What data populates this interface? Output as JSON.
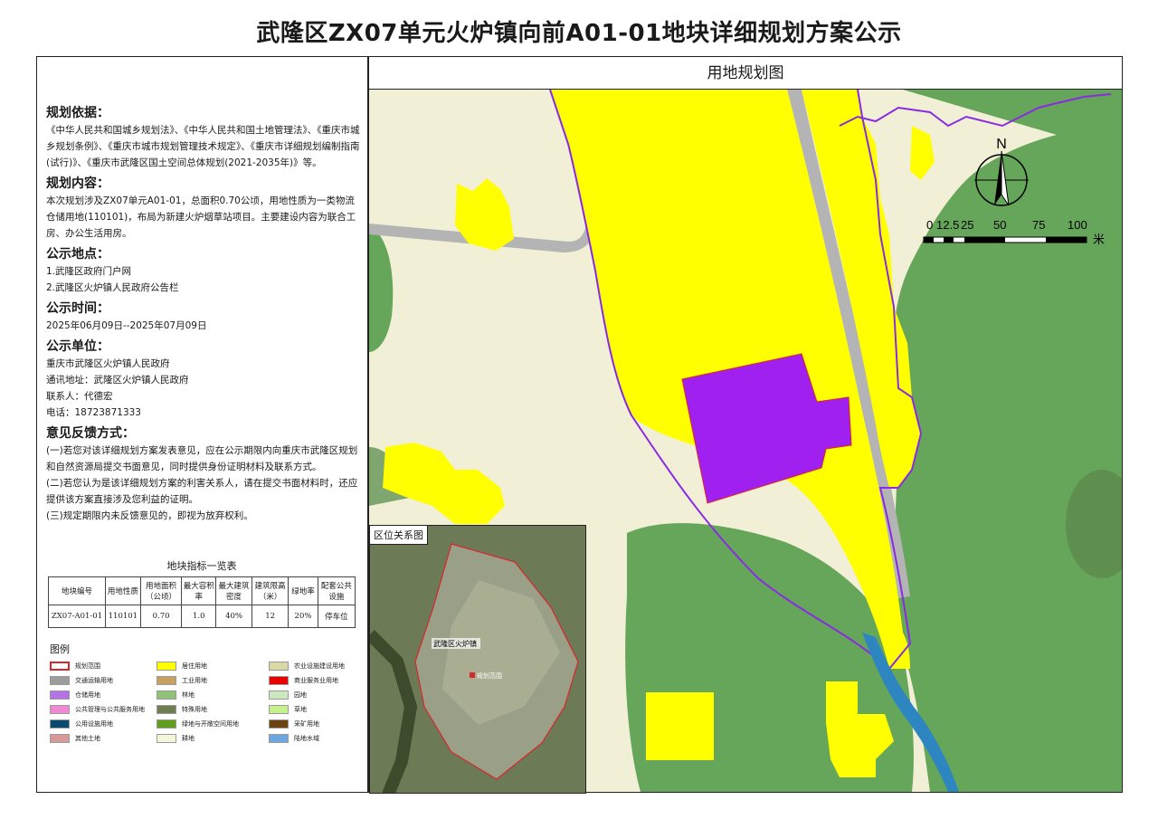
{
  "title": "武隆区ZX07单元火炉镇向前A01-01地块详细规划方案公示",
  "map_title": "用地规划图",
  "notice": {
    "basis_heading": "规划依据：",
    "basis_text": "《中华人民共和国城乡规划法》、《中华人民共和国土地管理法》、《重庆市城乡规划条例》、《重庆市城市规划管理技术规定》、《重庆市详细规划编制指南(试行)》、《重庆市武隆区国土空间总体规划(2021-2035年)》等。",
    "content_heading": "规划内容：",
    "content_text": "本次规划涉及ZX07单元A01-01，总面积0.70公顷，用地性质为一类物流仓储用地(110101)，布局为新建火炉烟草站项目。主要建设内容为联合工房、办公生活用房。",
    "location_heading": "公示地点：",
    "location_1": "1.武隆区政府门户网",
    "location_2": "2.武隆区火炉镇人民政府公告栏",
    "time_heading": "公示时间：",
    "time_text": "2025年06月09日--2025年07月09日",
    "unit_heading": "公示单位：",
    "unit_name": "重庆市武隆区火炉镇人民政府",
    "address": "通讯地址：武隆区火炉镇人民政府",
    "contact": "联系人：代德宏",
    "phone": "电话：18723871333",
    "feedback_heading": "意见反馈方式：",
    "feedback_1": "(一)若您对该详细规划方案发表意见，应在公示期限内向重庆市武隆区规划和自然资源局提交书面意见，同时提供身份证明材料及联系方式。",
    "feedback_2": "(二)若您认为是该详细规划方案的利害关系人，请在提交书面材料时，还应提供该方案直接涉及您利益的证明。",
    "feedback_3": "(三)规定期限内未反馈意见的，即视为放弃权利。"
  },
  "indicator_table": {
    "title": "地块指标一览表",
    "headers": [
      "地块编号",
      "用地性质",
      "用地面积（公顷）",
      "最大容积率",
      "最大建筑密度",
      "建筑限高（米）",
      "绿地率",
      "配套公共设施"
    ],
    "row": [
      "ZX07-A01-01",
      "110101",
      "0.70",
      "1.0",
      "40%",
      "12",
      "20%",
      "停车位"
    ]
  },
  "legend": {
    "title": "图例",
    "items": [
      {
        "label": "规划范围",
        "color": "#ffffff",
        "border": "#d9262c"
      },
      {
        "label": "居住用地",
        "color": "#ffff00"
      },
      {
        "label": "农业设施建设用地",
        "color": "#d9d9a6"
      },
      {
        "label": "交通运输用地",
        "color": "#9c9c9c"
      },
      {
        "label": "工业用地",
        "color": "#c8a062"
      },
      {
        "label": "商业服务业用地",
        "color": "#e60000"
      },
      {
        "label": "仓储用地",
        "color": "#b574e6"
      },
      {
        "label": "林地",
        "color": "#8fc276"
      },
      {
        "label": "园地",
        "color": "#cde8c0"
      },
      {
        "label": "公共管理与公共服务用地",
        "color": "#f08ad2"
      },
      {
        "label": "特殊用地",
        "color": "#6f7d52"
      },
      {
        "label": "草地",
        "color": "#c6f08c"
      },
      {
        "label": "公用设施用地",
        "color": "#0b4a6e"
      },
      {
        "label": "绿地与开敞空间用地",
        "color": "#5f9e1f"
      },
      {
        "label": "采矿用地",
        "color": "#6b4210"
      },
      {
        "label": "其他土地",
        "color": "#d69a9a"
      },
      {
        "label": "耕地",
        "color": "#f5f5dc"
      },
      {
        "label": "陆地水域",
        "color": "#6ea6e0"
      }
    ]
  },
  "inset": {
    "label": "区位关系图",
    "town_label": "武隆区火炉镇",
    "site_label": "规划范围"
  },
  "north_label": "N",
  "scale": {
    "ticks": [
      "0",
      "12.5",
      "25",
      "50",
      "75",
      "100"
    ],
    "unit": "米"
  },
  "colors": {
    "residential": "#ffff00",
    "forest": "#65a65a",
    "farmland": "#f1efd6",
    "road": "#b4b4b4",
    "warehouse": "#a020f0",
    "boundary": "#8a2be2",
    "water": "#2e86c1"
  }
}
